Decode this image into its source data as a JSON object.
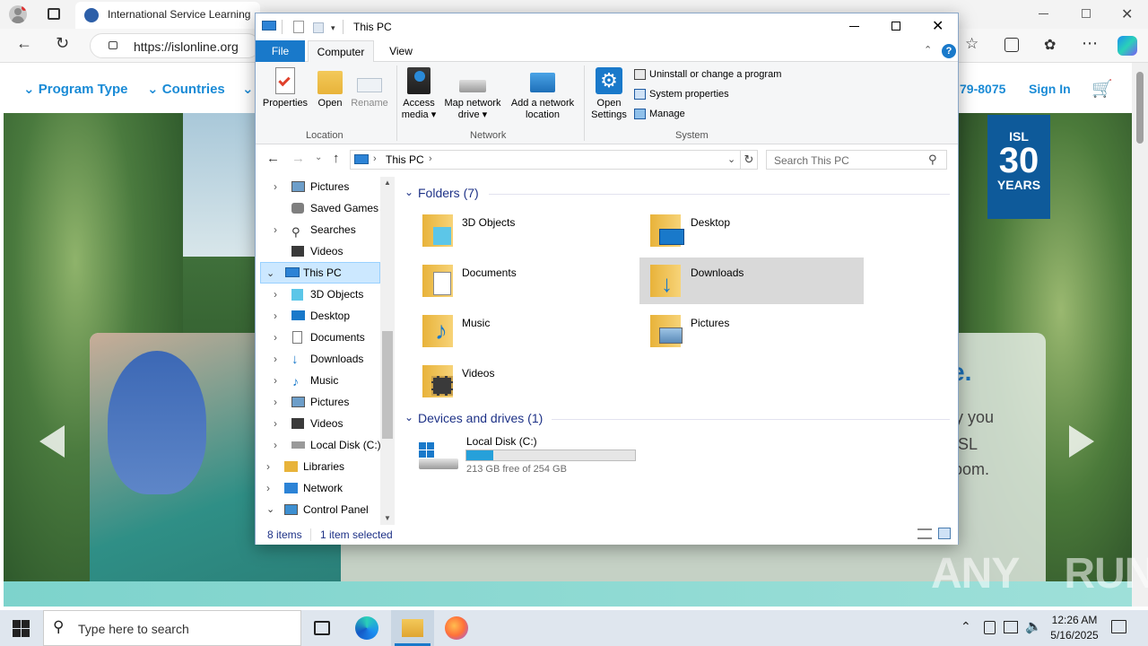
{
  "browser": {
    "tab_title": "International Service Learning",
    "url": "https://islonline.org"
  },
  "site": {
    "nav": [
      {
        "label": "Program Type"
      },
      {
        "label": "Countries"
      }
    ],
    "phone": "-8075",
    "phone_prefix": "79",
    "sign_in": "Sign In",
    "badge_top": "ISL",
    "badge_num": "30",
    "badge_bottom": "YEARS",
    "hero_text_1": "e.",
    "hero_text_2": "y you",
    "hero_text_3": "SL",
    "hero_text_4": "oom."
  },
  "explorer": {
    "title": "This PC",
    "tabs": {
      "file": "File",
      "computer": "Computer",
      "view": "View"
    },
    "ribbon": {
      "location": {
        "properties": "Properties",
        "open": "Open",
        "rename": "Rename",
        "group": "Location"
      },
      "network": {
        "access_media_1": "Access",
        "access_media_2": "media",
        "map_drive_1": "Map network",
        "map_drive_2": "drive",
        "add_location_1": "Add a network",
        "add_location_2": "location",
        "group": "Network"
      },
      "system": {
        "open_settings_1": "Open",
        "open_settings_2": "Settings",
        "uninstall": "Uninstall or change a program",
        "system_properties": "System properties",
        "manage": "Manage",
        "group": "System"
      }
    },
    "breadcrumb": "This PC",
    "search_placeholder": "Search This PC",
    "tree": [
      {
        "label": "Pictures"
      },
      {
        "label": "Saved Games"
      },
      {
        "label": "Searches"
      },
      {
        "label": "Videos"
      },
      {
        "label": "This PC"
      },
      {
        "label": "3D Objects"
      },
      {
        "label": "Desktop"
      },
      {
        "label": "Documents"
      },
      {
        "label": "Downloads"
      },
      {
        "label": "Music"
      },
      {
        "label": "Pictures"
      },
      {
        "label": "Videos"
      },
      {
        "label": "Local Disk (C:)"
      },
      {
        "label": "Libraries"
      },
      {
        "label": "Network"
      },
      {
        "label": "Control Panel"
      }
    ],
    "folders_header": "Folders (7)",
    "folders": [
      {
        "label": "3D Objects"
      },
      {
        "label": "Desktop"
      },
      {
        "label": "Documents"
      },
      {
        "label": "Downloads"
      },
      {
        "label": "Music"
      },
      {
        "label": "Pictures"
      },
      {
        "label": "Videos"
      }
    ],
    "devices_header": "Devices and drives (1)",
    "drive": {
      "label": "Local Disk (C:)",
      "free": "213 GB free of 254 GB",
      "used_fraction": 0.16
    },
    "status": {
      "items": "8 items",
      "selected": "1 item selected"
    }
  },
  "taskbar": {
    "search_placeholder": "Type here to search",
    "time": "12:26 AM",
    "date": "5/16/2025"
  },
  "watermark": {
    "left": "ANY",
    "right": "RUN"
  },
  "colors": {
    "accent": "#1979ca",
    "site_blue": "#1a8bd6",
    "selection": "#cce8ff",
    "badge": "#0e5a9a"
  }
}
